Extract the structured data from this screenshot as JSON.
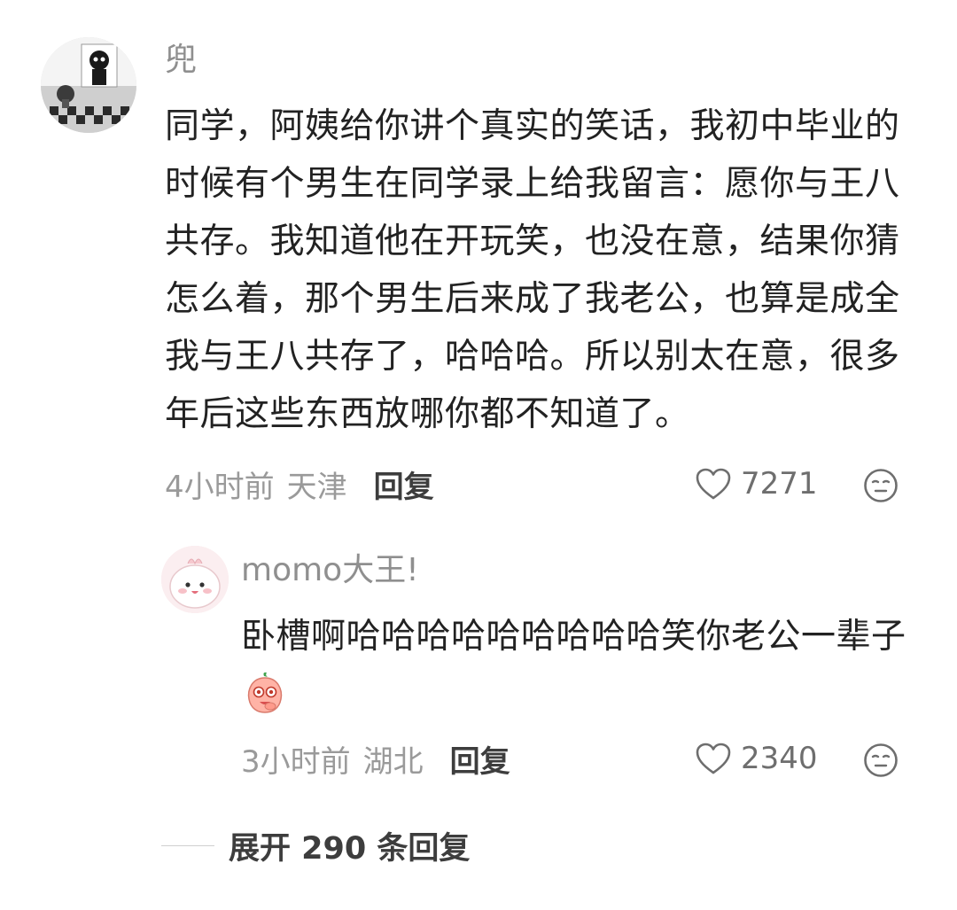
{
  "main_comment": {
    "username": "兜",
    "text": "同学，阿姨给你讲个真实的笑话，我初中毕业的时候有个男生在同学录上给我留言：愿你与王八共存。我知道他在开玩笑，也没在意，结果你猜怎么着，那个男生后来成了我老公，也算是成全我与王八共存了，哈哈哈。所以别太在意，很多年后这些东西放哪你都不知道了。",
    "time": "4小时前",
    "location": "天津",
    "reply_label": "回复",
    "like_count": "7271",
    "like_icon": "heart-outline-icon",
    "react_icon": "neutral-face-icon"
  },
  "reply_comment": {
    "username": "momo大王!",
    "text": "卧槽啊哈哈哈哈哈哈哈哈哈笑你老公一辈子",
    "inline_emoji": "peach-laughing-emoji",
    "time": "3小时前",
    "location": "湖北",
    "reply_label": "回复",
    "like_count": "2340",
    "like_icon": "heart-outline-icon",
    "react_icon": "neutral-face-icon"
  },
  "expand_replies": {
    "label": "展开 290 条回复"
  },
  "colors": {
    "text_primary": "#222222",
    "text_secondary": "#9a9a9a",
    "text_bold": "#3d3d3d"
  }
}
